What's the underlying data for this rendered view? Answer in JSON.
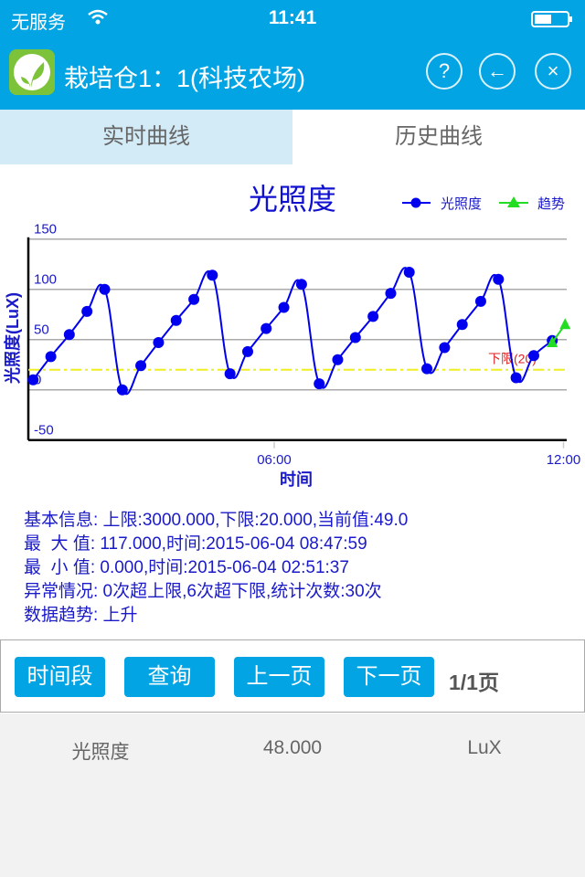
{
  "status_bar": {
    "carrier": "无服务",
    "time": "11:41",
    "battery_level": 0.45
  },
  "header": {
    "title": "栽培仓1：1(科技农场)",
    "help_label": "?",
    "back_label": "←",
    "close_label": "×",
    "color": "#03a4e3"
  },
  "tabs": [
    {
      "label": "实时曲线",
      "active": true
    },
    {
      "label": "历史曲线",
      "active": false
    }
  ],
  "chart_data": {
    "type": "line",
    "title": "光照度",
    "xlabel": "时间",
    "ylabel": "光照度(LuX)",
    "ylim": [
      -50,
      150
    ],
    "yticks": [
      "150",
      "100",
      "50",
      "0",
      "-50"
    ],
    "xticks": [
      "06:00",
      "12:00"
    ],
    "xlim": [
      "00:54",
      "12:04"
    ],
    "grid": true,
    "legend_placement": "top-right",
    "legend": [
      "光照度",
      "趋势"
    ],
    "series": [
      {
        "name": "光照度",
        "color": "#0000ee",
        "marker": "circle",
        "x": [
          "01:00",
          "01:22",
          "01:45",
          "02:07",
          "02:29",
          "02:51",
          "03:14",
          "03:36",
          "03:58",
          "04:20",
          "04:43",
          "05:05",
          "05:27",
          "05:50",
          "06:12",
          "06:34",
          "06:56",
          "07:19",
          "07:41",
          "08:03",
          "08:25",
          "08:48",
          "09:10",
          "09:32",
          "09:54",
          "10:17",
          "10:39",
          "11:01",
          "11:23",
          "11:46"
        ],
        "values": [
          10,
          33,
          55,
          78,
          100,
          0,
          24,
          47,
          69,
          90,
          114,
          16,
          38,
          61,
          82,
          105,
          6,
          30,
          52,
          73,
          96,
          117,
          21,
          42,
          65,
          88,
          110,
          12,
          34,
          49
        ]
      },
      {
        "name": "趋势",
        "color": "#22dd22",
        "marker": "triangle",
        "x": [
          "11:46",
          "12:02"
        ],
        "values": [
          47,
          65
        ]
      }
    ],
    "lower_limit": {
      "value": 20,
      "label": "下限(20)",
      "color": "#eeee22",
      "label_color": "#dd2222"
    }
  },
  "info": {
    "lines": [
      "基本信息: 上限:3000.000,下限:20.000,当前值:49.0",
      "最  大 值: 117.000,时间:2015-06-04 08:47:59",
      "最  小 值: 0.000,时间:2015-06-04 02:51:37",
      "异常情况: 0次超上限,6次超下限,统计次数:30次",
      "数据趋势: 上升"
    ]
  },
  "toolbar": {
    "period_label": "时间段",
    "query_label": "查询",
    "prev_label": "上一页",
    "next_label": "下一页",
    "page_indicator": "1/1页"
  },
  "reading": {
    "name": "光照度",
    "value": "48.000",
    "unit": "LuX"
  }
}
